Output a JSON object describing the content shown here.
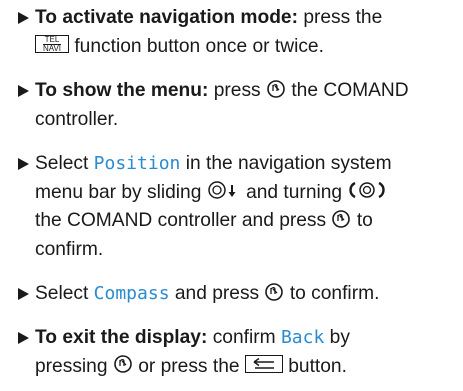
{
  "steps": [
    {
      "bold": "To activate navigation mode:",
      "text1": "press the",
      "button": {
        "top": "TEL",
        "bottom": "NAVI"
      },
      "text2": "function button once or twice."
    },
    {
      "bold": "To show the menu:",
      "text1": "press",
      "text2": "the COMAND",
      "text3": "controller."
    },
    {
      "line1": "Select",
      "term": "Position",
      "line1b": "in the navigation system",
      "line2a": "menu bar by sliding",
      "line2b": "and turning",
      "line3a": "the COMAND controller and press",
      "line3b": "to",
      "line4": "confirm."
    },
    {
      "text1": "Select",
      "term": "Compass",
      "text2": "and press",
      "text3": "to confirm."
    },
    {
      "bold": "To exit the display:",
      "text1": "confirm",
      "term": "Back",
      "text2": "by",
      "text3": "pressing",
      "text4": "or press the",
      "text5": "button."
    }
  ],
  "icons": {
    "press": "controller-press-icon",
    "slide_down": "controller-slide-down-icon",
    "turn": "controller-turn-icon",
    "back": "back-button-icon"
  },
  "colors": {
    "term": "#2a8bd0",
    "text": "#1a1a1a"
  }
}
